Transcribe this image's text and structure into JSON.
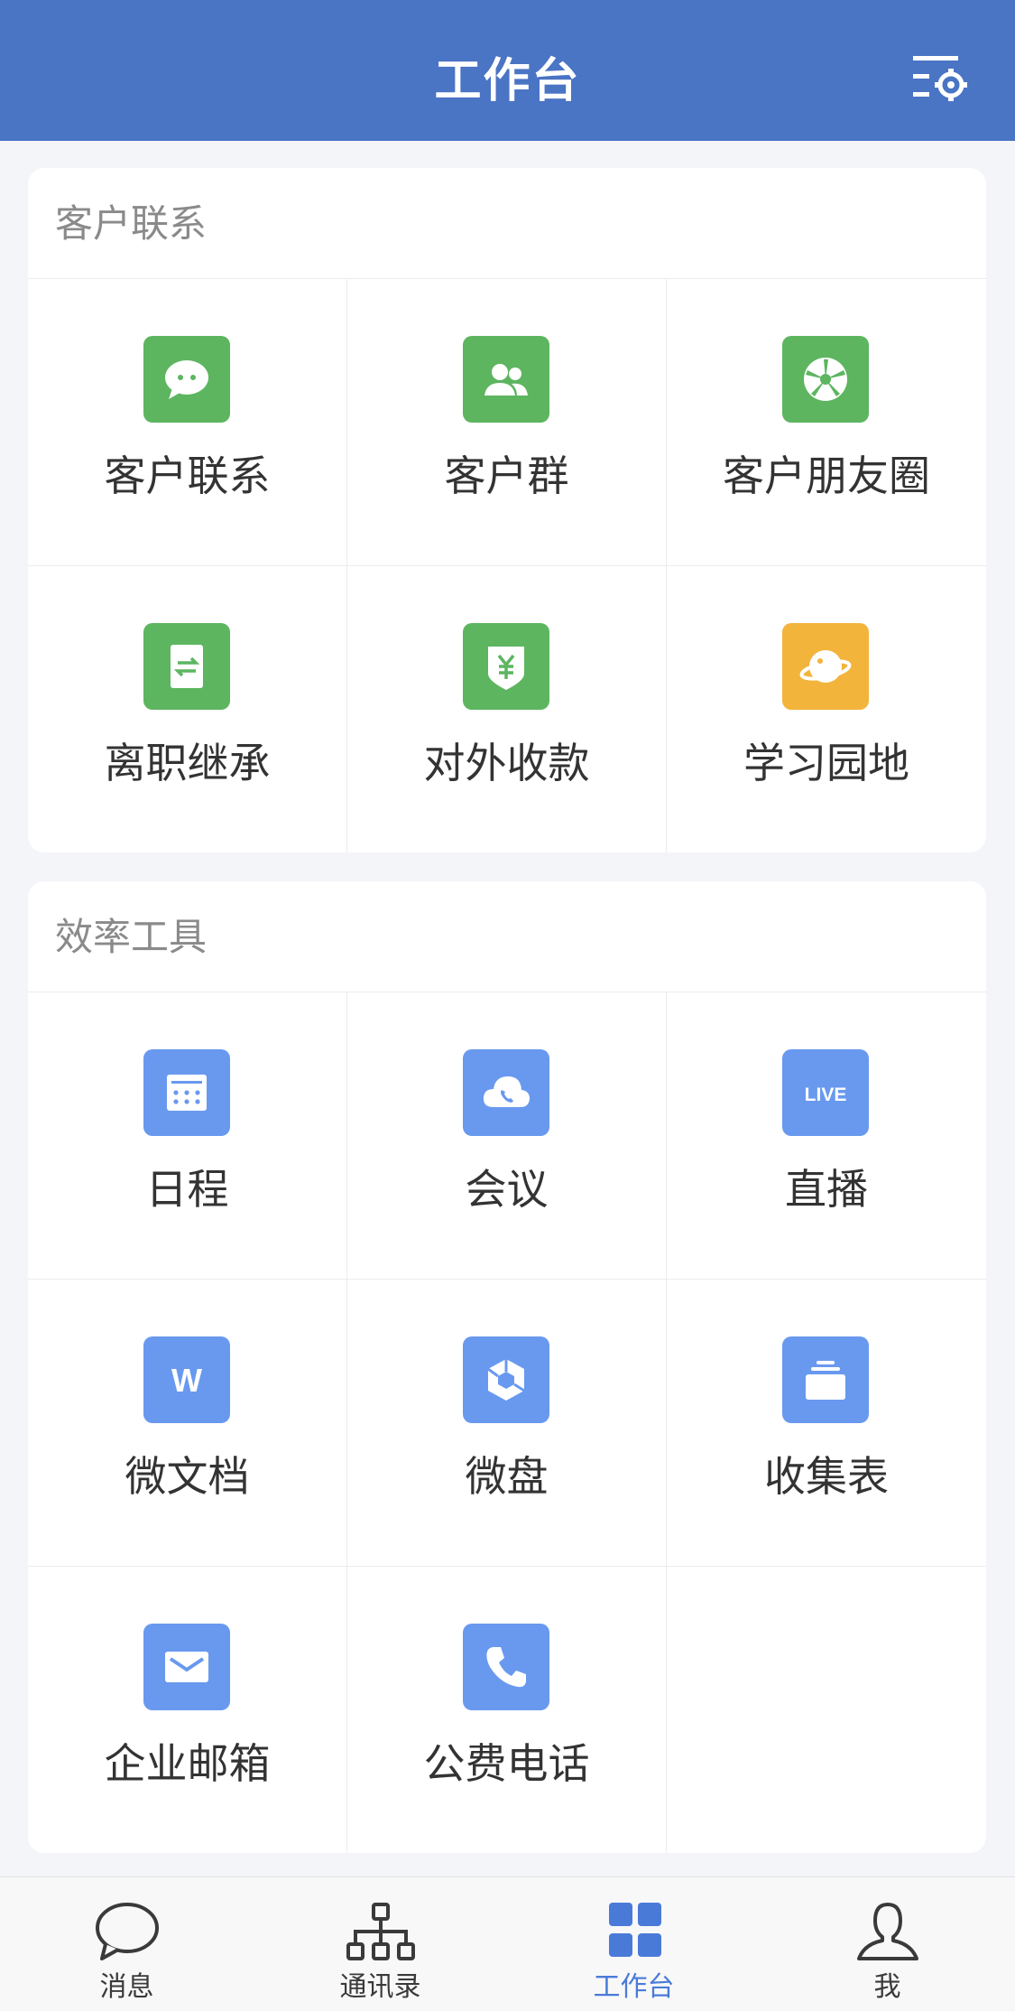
{
  "header": {
    "title": "工作台",
    "settings_icon": "list-settings-icon"
  },
  "sections": [
    {
      "title": "客户联系",
      "items": [
        {
          "label": "客户联系",
          "icon": "chat-bubble-icon",
          "color": "#5db560"
        },
        {
          "label": "客户群",
          "icon": "group-icon",
          "color": "#5db560"
        },
        {
          "label": "客户朋友圈",
          "icon": "aperture-icon",
          "color": "#5db560"
        },
        {
          "label": "离职继承",
          "icon": "transfer-document-icon",
          "color": "#5db560"
        },
        {
          "label": "对外收款",
          "icon": "yuan-shield-icon",
          "color": "#5db560"
        },
        {
          "label": "学习园地",
          "icon": "planet-icon",
          "color": "#f3b43c"
        }
      ]
    },
    {
      "title": "效率工具",
      "items": [
        {
          "label": "日程",
          "icon": "calendar-icon",
          "color": "#6999ef"
        },
        {
          "label": "会议",
          "icon": "cloud-phone-icon",
          "color": "#6999ef"
        },
        {
          "label": "直播",
          "icon": "live-icon",
          "color": "#6999ef",
          "icon_text": "LIVE"
        },
        {
          "label": "微文档",
          "icon": "document-w-icon",
          "color": "#6999ef",
          "icon_text": "W"
        },
        {
          "label": "微盘",
          "icon": "cube-drive-icon",
          "color": "#6999ef"
        },
        {
          "label": "收集表",
          "icon": "stacked-forms-icon",
          "color": "#6999ef"
        },
        {
          "label": "企业邮箱",
          "icon": "mail-icon",
          "color": "#6999ef"
        },
        {
          "label": "公费电话",
          "icon": "phone-icon",
          "color": "#6999ef"
        }
      ]
    }
  ],
  "tabbar": {
    "active_color": "#4a7ad8",
    "tabs": [
      {
        "label": "消息",
        "icon": "message-bubble-icon",
        "active": false
      },
      {
        "label": "通讯录",
        "icon": "org-chart-icon",
        "active": false
      },
      {
        "label": "工作台",
        "icon": "workbench-grid-icon",
        "active": true
      },
      {
        "label": "我",
        "icon": "person-icon",
        "active": false
      }
    ]
  }
}
